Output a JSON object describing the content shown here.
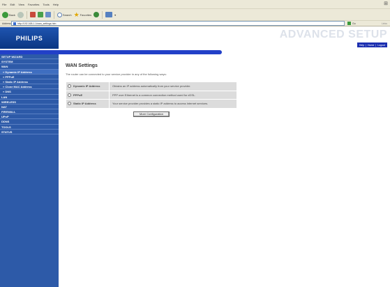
{
  "browser": {
    "menu": [
      "File",
      "Edit",
      "View",
      "Favorites",
      "Tools",
      "Help"
    ],
    "toolbar": {
      "back_label": "Back",
      "search_label": "Search",
      "favorites_label": "Favorites"
    },
    "address": {
      "label": "Address",
      "url": "http://192.168.1.1/wan_settings.htm",
      "go_label": "Go",
      "links_label": "Links"
    }
  },
  "header": {
    "logo": "PHILIPS",
    "banner_title": "ADVANCED SETUP",
    "links": [
      "Help",
      "Home",
      "Logout"
    ]
  },
  "sidebar": {
    "items": [
      {
        "label": "SETUP WIZARD",
        "sub": false
      },
      {
        "label": "SYSTEM",
        "sub": false
      },
      {
        "label": "WAN",
        "sub": false
      },
      {
        "label": "» Dynamic IP Address",
        "sub": true,
        "active": true
      },
      {
        "label": "» PPPoE",
        "sub": true
      },
      {
        "label": "» Static IP Address",
        "sub": true
      },
      {
        "label": "» Clone MAC Address",
        "sub": true
      },
      {
        "label": "» DNS",
        "sub": true
      },
      {
        "label": "LAN",
        "sub": false
      },
      {
        "label": "WIRELESS",
        "sub": false
      },
      {
        "label": "NAT",
        "sub": false
      },
      {
        "label": "FIREWALL",
        "sub": false
      },
      {
        "label": "UPnP",
        "sub": false
      },
      {
        "label": "DDNS",
        "sub": false
      },
      {
        "label": "TOOLS",
        "sub": false
      },
      {
        "label": "STATUS",
        "sub": false
      }
    ]
  },
  "main": {
    "title": "WAN Settings",
    "intro": "The router can be connected to your service provider in any of the following ways:",
    "options": [
      {
        "label": "Dynamic IP Address",
        "desc": "Obtains an IP address automatically from your service provider."
      },
      {
        "label": "PPPoE",
        "desc": "PPP over Ethernet is a common connection method used for xDSL."
      },
      {
        "label": "Static IP Address",
        "desc": "Your service provider provides a static IP address to access Internet services."
      }
    ],
    "button_label": "More Configuration"
  }
}
